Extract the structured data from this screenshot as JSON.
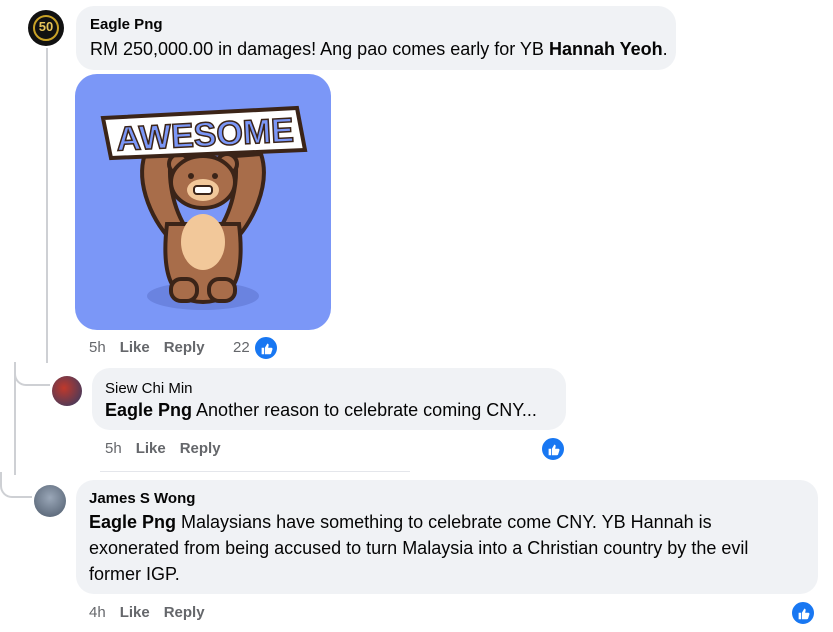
{
  "comments": [
    {
      "author": "Eagle Png",
      "text_before": "RM 250,000.00 in damages! Ang pao comes early for YB ",
      "text_bold": "Hannah Yeoh",
      "text_after": ".",
      "sticker_text": "AWESOME",
      "time": "5h",
      "like_label": "Like",
      "reply_label": "Reply",
      "reaction_count": "22",
      "avatar_badge": "50"
    },
    {
      "author": "Siew Chi Min",
      "tag": "Eagle Png",
      "text": " Another reason to celebrate coming CNY...",
      "time": "5h",
      "like_label": "Like",
      "reply_label": "Reply"
    },
    {
      "author": "James S Wong",
      "tag": "Eagle Png",
      "text": " Malaysians have something to celebrate come CNY. YB Hannah is exonerated from being accused to turn Malaysia into a Christian country by the evil former IGP.",
      "time": "4h",
      "like_label": "Like",
      "reply_label": "Reply"
    }
  ],
  "colors": {
    "accent": "#1877f2",
    "bubble": "#f0f2f5",
    "sticker_bg": "#7b97f7",
    "bear": "#a86d4a"
  },
  "icons": [
    "thumbs-up-icon"
  ]
}
